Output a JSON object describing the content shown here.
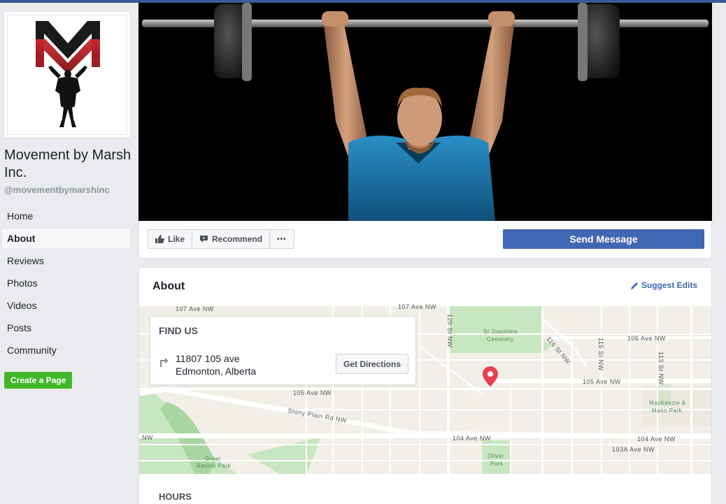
{
  "page": {
    "name": "Movement by Marsh Inc.",
    "handle": "@movementbymarshinc",
    "logo_monogram": "M"
  },
  "nav": {
    "items": [
      {
        "label": "Home",
        "active": false
      },
      {
        "label": "About",
        "active": true
      },
      {
        "label": "Reviews",
        "active": false
      },
      {
        "label": "Photos",
        "active": false
      },
      {
        "label": "Videos",
        "active": false
      },
      {
        "label": "Posts",
        "active": false
      },
      {
        "label": "Community",
        "active": false
      }
    ],
    "create_page_label": "Create a Page"
  },
  "actions": {
    "like_label": "Like",
    "recommend_label": "Recommend",
    "more_label": "•••",
    "send_message_label": "Send Message"
  },
  "about": {
    "title": "About",
    "suggest_edits_label": "Suggest Edits",
    "find_us_title": "FIND US",
    "address_line1": "11807 105 ave",
    "address_line2": "Edmonton, Alberta",
    "get_directions_label": "Get Directions",
    "hours_title": "HOURS"
  },
  "map": {
    "labels": {
      "ave107_left": "107 Ave NW",
      "ave107_mid": "107 Ave NW",
      "ave106": "106 Ave NW",
      "ave105_left": "105 Ave NW",
      "ave105_right": "105 Ave NW",
      "stony_plain": "Stony Plain Rd NW",
      "ave104_mid": "104 Ave NW",
      "ave104_right": "104 Ave NW",
      "ave103a": "103A Ave NW",
      "st120": "120 St NW",
      "st116": "116 St NW",
      "st115": "115 St NW",
      "st113": "113 St NW",
      "nw_left": "NW",
      "cemetery1": "St Joachims",
      "cemetery2": "Cemetery",
      "mackenzie1": "MacKenzie &",
      "mackenzie2": "Mann Park",
      "oliver1": "Oliver",
      "oliver2": "Park",
      "groat1": "Groat",
      "groat2": "Ravine Park"
    },
    "colors": {
      "road": "#ffffff",
      "land": "#f2efe9",
      "park": "#c8e6c0",
      "pin": "#e8404f"
    }
  },
  "colors": {
    "brand_blue": "#4267b2",
    "top_bar": "#3b5998",
    "create_green": "#42b72a",
    "logo_red": "#b0171e"
  }
}
